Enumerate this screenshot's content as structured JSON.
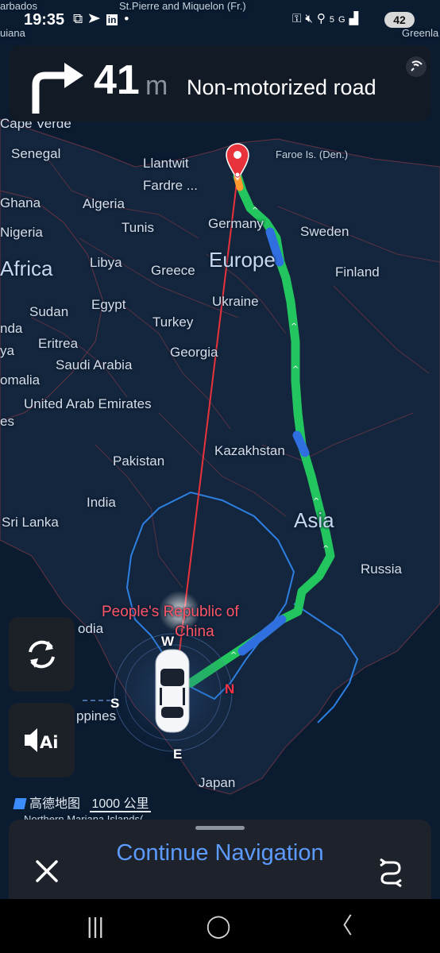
{
  "status_bar": {
    "time": "19:35",
    "battery": "42",
    "left_icons": [
      "screenshot-icon",
      "telegram-icon",
      "linkedin-icon",
      "dot-icon"
    ],
    "right_icons": [
      "key-icon",
      "mute-icon",
      "location-icon",
      "5g-icon",
      "signal-icon"
    ]
  },
  "instruction": {
    "distance": "41",
    "unit": "m",
    "road": "Non-motorized road"
  },
  "map": {
    "labels": {
      "barbados": "arbados",
      "st_pierre": "St.Pierre and Miquelon (Fr.)",
      "guiana": "uiana",
      "greenland": "Greenla",
      "cape_verde": "Cape Verde",
      "senegal": "Senegal",
      "llantwit": "Llantwit",
      "fardre": "Fardre ...",
      "faroe": "Faroe Is. (Den.)",
      "ghana": "Ghana",
      "algeria": "Algeria",
      "tunis": "Tunis",
      "germany": "Germany",
      "sweden": "Sweden",
      "nigeria": "Nigeria",
      "libya": "Libya",
      "greece": "Greece",
      "europe": "Europe",
      "africa": "Africa",
      "finland": "Finland",
      "egypt": "Egypt",
      "ukraine": "Ukraine",
      "sudan": "Sudan",
      "turkey": "Turkey",
      "nda": "nda",
      "eritrea": "Eritrea",
      "georgia": "Georgia",
      "ya": "ya",
      "saudi": "Saudi Arabia",
      "omalia": "omalia",
      "uae": "United Arab Emirates",
      "es": "es",
      "pakistan": "Pakistan",
      "kazakhstan": "Kazakhstan",
      "india": "India",
      "asia": "Asia",
      "srilanka": "Sri Lanka",
      "russia": "Russia",
      "china1": "People's Republic of",
      "china2": "China",
      "odia": "odia",
      "ppines": "ppines",
      "japan": "Japan",
      "marianas": "Northern Mariana Islands("
    },
    "compass": {
      "n": "N",
      "s": "S",
      "e": "E",
      "w": "W"
    },
    "logo_text": "高德地图",
    "scale": "1000 公里"
  },
  "side_buttons": {
    "refresh": "refresh-icon",
    "voice": "voice-ai-icon"
  },
  "bottom_panel": {
    "title": "Continue Navigation"
  },
  "colors": {
    "route_green": "#22c55e",
    "route_blue": "#2f6fe0",
    "accent": "#5d9bff",
    "pin_red": "#e8323c"
  }
}
